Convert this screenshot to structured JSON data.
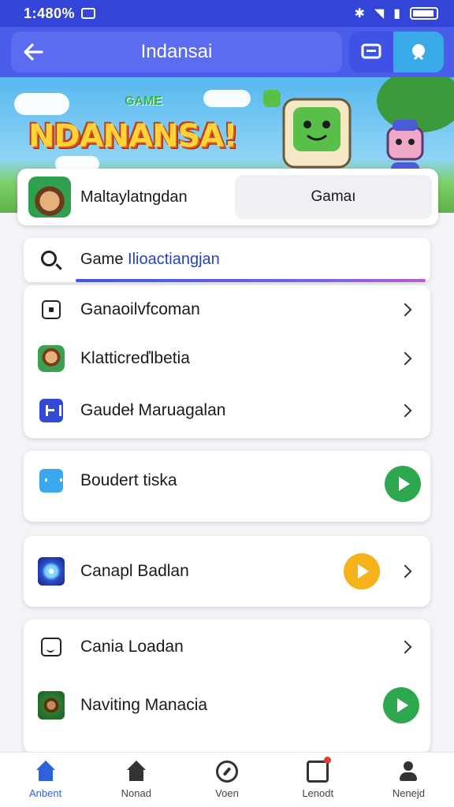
{
  "status": {
    "time": "1:480%"
  },
  "header": {
    "title": "Indansai"
  },
  "banner": {
    "title": "NDANANSA!",
    "subtitle": "GAME"
  },
  "profile": {
    "name": "Maltaylatngdan",
    "button_label": "Gamaı"
  },
  "search": {
    "text_primary": "Game",
    "text_secondary": "Ilioactiangjan"
  },
  "menu_card": {
    "items": [
      {
        "label": "Ganaoilvfcoman",
        "icon": "square-icon"
      },
      {
        "label": "Klatticreďlbetia",
        "icon": "character-icon"
      },
      {
        "label": "Gaudeł Maruagalan",
        "icon": "grid-icon"
      }
    ]
  },
  "card2": {
    "label": "Boudert tiska",
    "icon": "controller-icon"
  },
  "card3": {
    "label": "Canapl Badlan",
    "icon": "spark-icon"
  },
  "card4": {
    "items": [
      {
        "label": "Cania Loadan",
        "icon": "emoji-icon"
      },
      {
        "label": "Naviting Manacia",
        "icon": "jungle-icon"
      }
    ]
  },
  "bottom_nav": {
    "items": [
      {
        "label": "Anbent",
        "icon": "home-icon",
        "active": true
      },
      {
        "label": "Nonad",
        "icon": "home-outline-icon",
        "active": false
      },
      {
        "label": "Voen",
        "icon": "compass-icon",
        "active": false
      },
      {
        "label": "Lenodt",
        "icon": "inbox-icon",
        "active": false
      },
      {
        "label": "Nenejd",
        "icon": "user-icon",
        "active": false
      }
    ]
  },
  "colors": {
    "primary": "#4a5de8",
    "status_bar": "#3344d8",
    "play_green": "#2ea84f",
    "play_yellow": "#f6b21a"
  }
}
